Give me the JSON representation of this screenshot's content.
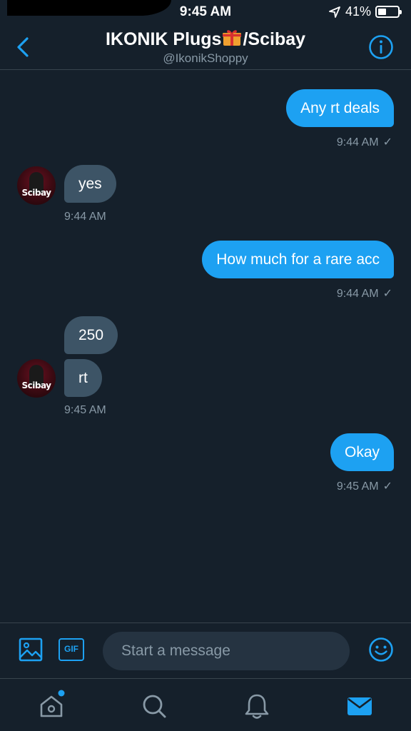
{
  "status_bar": {
    "time": "9:45 AM",
    "battery_pct": "41%",
    "battery_level": 0.41
  },
  "header": {
    "title_left": "IKONIK Plugs",
    "title_right": "/Scibay",
    "handle": "@IkonikShoppy"
  },
  "messages": [
    {
      "dir": "sent",
      "text": "Any rt deals",
      "time": "9:44 AM"
    },
    {
      "dir": "recv",
      "text": "yes",
      "time": "9:44 AM"
    },
    {
      "dir": "sent",
      "text": "How much for a rare acc",
      "time": "9:44 AM"
    },
    {
      "dir": "recv",
      "text": "250"
    },
    {
      "dir": "recv",
      "text": "rt",
      "time": "9:45 AM"
    },
    {
      "dir": "sent",
      "text": "Okay",
      "time": "9:45 AM"
    }
  ],
  "avatar_label": "Scibay",
  "read_mark": "✓",
  "composer": {
    "placeholder": "Start a message",
    "gif_label": "GIF"
  },
  "colors": {
    "background": "#15202b",
    "sent_bubble": "#1da1f2",
    "recv_bubble": "#3d5466",
    "muted": "#8899a6",
    "accent": "#1da1f2"
  },
  "icons": [
    "back-chevron-icon",
    "info-icon",
    "gift-icon",
    "image-icon",
    "gif-icon",
    "emoji-icon",
    "home-icon",
    "search-icon",
    "bell-icon",
    "mail-icon"
  ]
}
